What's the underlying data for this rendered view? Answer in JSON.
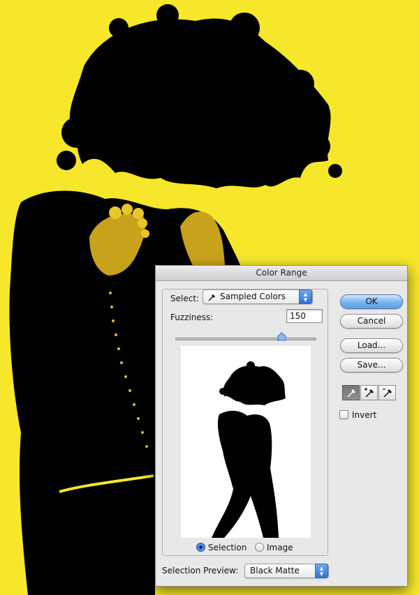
{
  "dialog": {
    "title": "Color Range",
    "select_label": "Select:",
    "select_value": "Sampled Colors",
    "fuzziness_label": "Fuzziness:",
    "fuzziness_value": "150",
    "fuzziness_slider_fraction": 0.75,
    "radio_options": [
      {
        "label": "Selection",
        "selected": true
      },
      {
        "label": "Image",
        "selected": false
      }
    ],
    "selection_preview_label": "Selection Preview:",
    "selection_preview_value": "Black Matte",
    "buttons": {
      "ok": "OK",
      "cancel": "Cancel",
      "load": "Load...",
      "save": "Save..."
    },
    "eyedropper_tools": [
      "eyedropper-icon",
      "eyedropper-plus-icon",
      "eyedropper-minus-icon"
    ],
    "invert_label": "Invert",
    "invert_checked": false
  },
  "colors": {
    "background_yellow": "#f6e72a",
    "silhouette": "#000000",
    "accent_blue": "#3a7fe0"
  }
}
